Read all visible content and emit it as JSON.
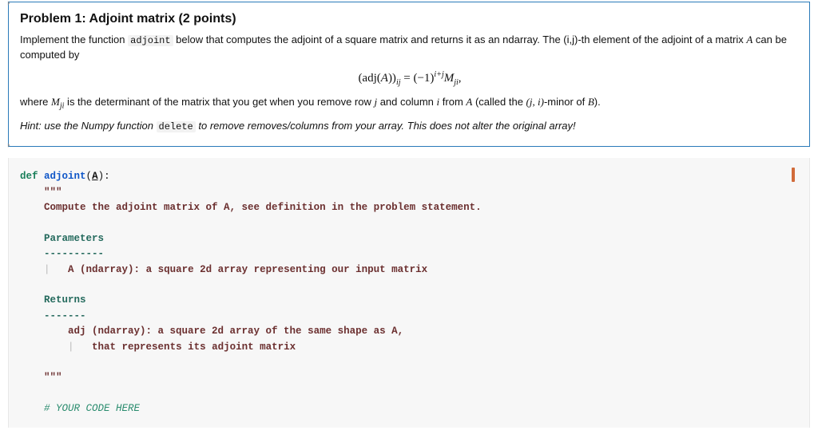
{
  "toolbar": {
    "run_label": "▾",
    "add_label": "+",
    "cell_label": "▾",
    "more_label": "···"
  },
  "markdown": {
    "heading": "Problem 1: Adjoint matrix (2 points)",
    "para1_a": "Implement the function ",
    "para1_code1": "adjoint",
    "para1_b": " below that computes the adjoint of a square matrix and returns it as an ndarray. The (i,j)-th element of the adjoint of a matrix ",
    "para1_A": "A",
    "para1_c": " can be computed by",
    "equation": "(adj(A))ᵢⱼ = (−1)ⁱ⁺ʲ Mⱼᵢ,",
    "para2_a": "where ",
    "para2_Mji": "Mⱼᵢ",
    "para2_b": " is the determinant of the matrix that you get when you remove row ",
    "para2_j": "j",
    "para2_c": " and column ",
    "para2_i": "i",
    "para2_d": " from ",
    "para2_A": "A",
    "para2_e": " (called the ",
    "para2_ji": "(j, i)",
    "para2_f": "-minor of ",
    "para2_B": "B",
    "para2_g": ").",
    "hint_a": "Hint: use the Numpy function ",
    "hint_code": "delete",
    "hint_b": " to remove removes/columns from your array. This does not alter the original array!"
  },
  "code": {
    "def_kw": "def",
    "def_name": "adjoint",
    "def_args_open": "(",
    "def_arg": "A",
    "def_args_close": "):",
    "triple1": "\"\"\"",
    "docline1": "Compute the adjoint matrix of A, see definition in the problem statement.",
    "params_hdr": "Parameters",
    "dashes10": "----------",
    "params_line": "A (ndarray): a square 2d array representing our input matrix",
    "returns_hdr": "Returns",
    "dashes7": "-------",
    "returns_line1": "adj (ndarray): a square 2d array of the same shape as A,",
    "returns_line2": "that represents its adjoint matrix",
    "triple2": "\"\"\"",
    "todo": "# YOUR CODE HERE"
  }
}
